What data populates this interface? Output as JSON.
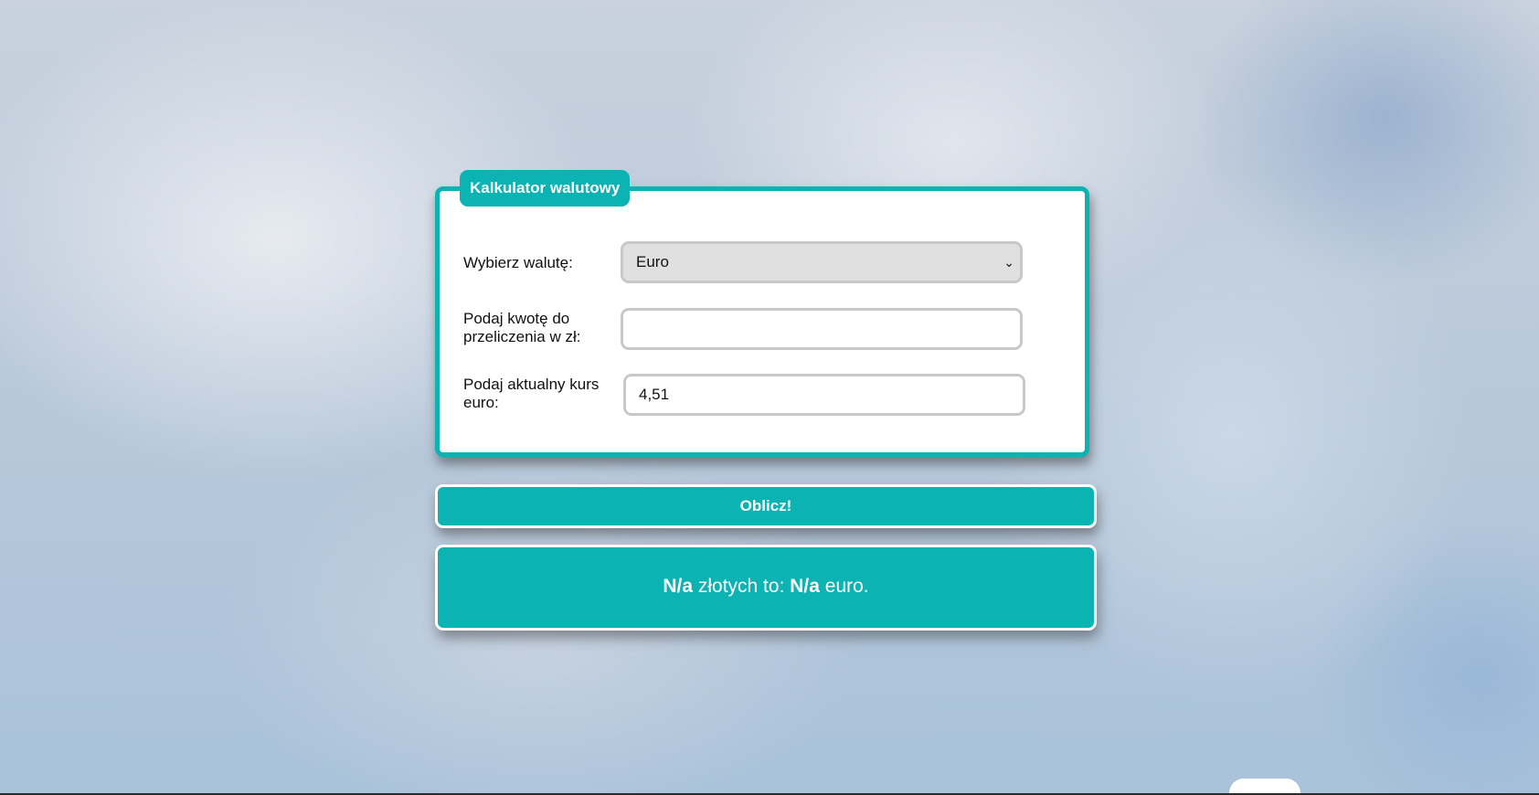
{
  "form": {
    "legend": "Kalkulator walutowy",
    "currency_label": "Wybierz walutę:",
    "currency_selected": "Euro",
    "amount_label": "Podaj kwotę do przeliczenia w zł:",
    "amount_value": "",
    "rate_label": "Podaj aktualny kurs euro:",
    "rate_value": "4,51"
  },
  "actions": {
    "calculate_label": "Oblicz!"
  },
  "result": {
    "pln_value": "N/a",
    "middle_text": " złotych to: ",
    "converted_value": "N/a",
    "currency_suffix": " euro."
  },
  "colors": {
    "accent": "#0bb3b3",
    "field_border": "#c8c8c8",
    "select_background": "#e0e0e0"
  }
}
